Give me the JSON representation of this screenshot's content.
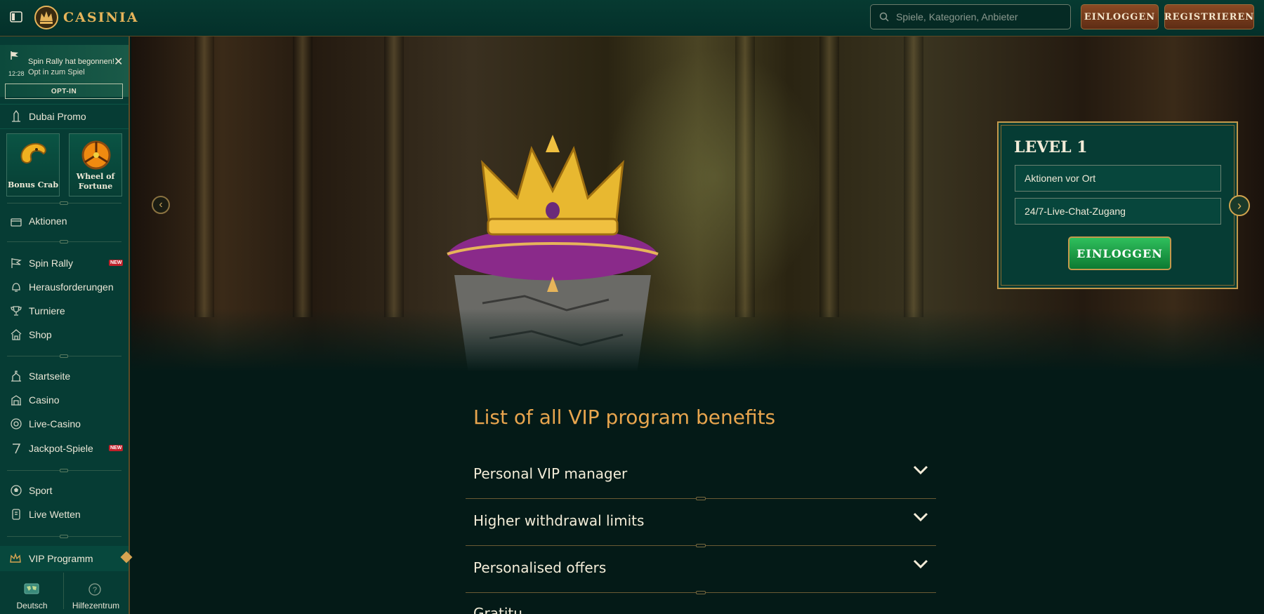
{
  "header": {
    "logo_text": "CASINIA",
    "search_placeholder": "Spiele, Kategorien, Anbieter",
    "login_label": "EINLOGGEN",
    "register_label": "REGISTRIEREN"
  },
  "sidebar": {
    "notification": {
      "time": "12:28",
      "title": "Spin Rally hat begonnen!",
      "subtitle": "Opt in zum Spiel",
      "button": "OPT-IN"
    },
    "promo": "Dubai Promo",
    "tiles": [
      {
        "label1": "Bonus Crab",
        "label2": ""
      },
      {
        "label1": "Wheel of",
        "label2": "Fortune"
      }
    ],
    "items": [
      {
        "label": "Aktionen",
        "icon": "gift-icon"
      },
      {
        "label": "Spin Rally",
        "icon": "flag-icon",
        "badge": "NEW"
      },
      {
        "label": "Herausforderungen",
        "icon": "bell-icon"
      },
      {
        "label": "Turniere",
        "icon": "trophy-icon"
      },
      {
        "label": "Shop",
        "icon": "shop-icon"
      },
      {
        "label": "Startseite",
        "icon": "home-icon"
      },
      {
        "label": "Casino",
        "icon": "casino-icon"
      },
      {
        "label": "Live-Casino",
        "icon": "chip-icon"
      },
      {
        "label": "Jackpot-Spiele",
        "icon": "seven-icon",
        "badge": "NEW"
      },
      {
        "label": "Sport",
        "icon": "football-icon"
      },
      {
        "label": "Live Wetten",
        "icon": "live-bet-icon"
      }
    ],
    "vip": "VIP Programm",
    "language": "Deutsch",
    "help": "Hilfezentrum"
  },
  "hero": {
    "level_title": "LEVEL 1",
    "perks": [
      "Aktionen vor Ort",
      "24/7-Live-Chat-Zugang"
    ],
    "login_button": "EINLOGGEN"
  },
  "benefits": {
    "title": "List of all VIP program benefits",
    "items": [
      "Personal VIP manager",
      "Higher withdrawal limits",
      "Personalised offers",
      "Gratitu... "
    ]
  },
  "colors": {
    "background": "#041a17",
    "sidebar": "#063c34",
    "gold": "#e6b45a",
    "heading_orange": "#e8a54e",
    "green_button": "#1a9a44"
  }
}
